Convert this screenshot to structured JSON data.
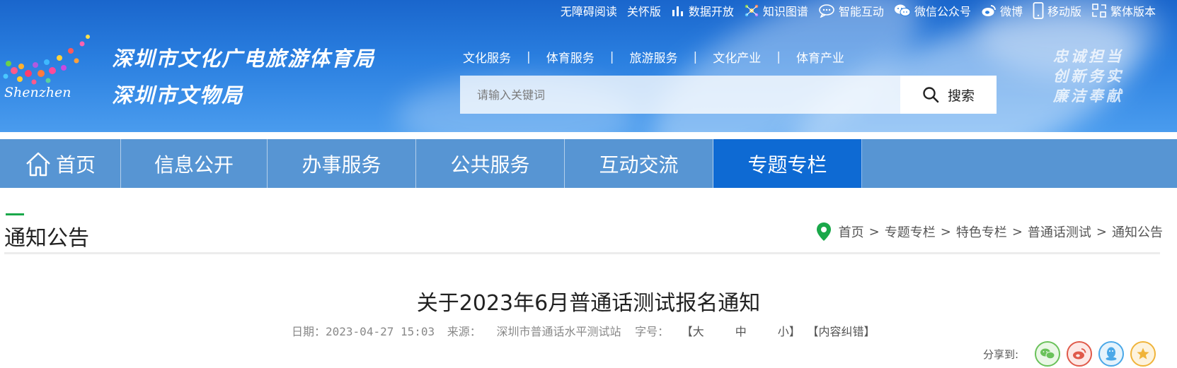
{
  "topbar": {
    "items": [
      {
        "label": "无障碍阅读",
        "icon": "none"
      },
      {
        "label": "关怀版",
        "icon": "none"
      },
      {
        "label": "数据开放",
        "icon": "bar-chart-icon"
      },
      {
        "label": "知识图谱",
        "icon": "knowledge-graph-icon"
      },
      {
        "label": "智能互动",
        "icon": "chat-bubble-icon"
      },
      {
        "label": "微信公众号",
        "icon": "wechat-icon"
      },
      {
        "label": "微博",
        "icon": "weibo-icon"
      },
      {
        "label": "移动版",
        "icon": "mobile-icon"
      },
      {
        "label": "繁体版本",
        "icon": "traditional-chinese-icon"
      }
    ]
  },
  "brand": {
    "logo_text": "Shenzhen",
    "org_name_1": "深圳市文化广电旅游体育局",
    "org_name_2": "深圳市文物局",
    "slogan": [
      "忠诚担当",
      "创新务实",
      "廉洁奉献"
    ]
  },
  "subnav": [
    "文化服务",
    "体育服务",
    "旅游服务",
    "文化产业",
    "体育产业"
  ],
  "subnav_separator": "|",
  "search": {
    "placeholder": "请输入关键词",
    "button_label": "搜索"
  },
  "mainnav": [
    {
      "label": "首页",
      "active": false
    },
    {
      "label": "信息公开",
      "active": false
    },
    {
      "label": "办事服务",
      "active": false
    },
    {
      "label": "公共服务",
      "active": false
    },
    {
      "label": "互动交流",
      "active": false
    },
    {
      "label": "专题专栏",
      "active": true
    }
  ],
  "section": {
    "title": "通知公告"
  },
  "breadcrumb": {
    "items": [
      "首页",
      "专题专栏",
      "特色专栏",
      "普通话测试",
      "通知公告"
    ],
    "separator": ">"
  },
  "article": {
    "title": "关于2023年6月普通话测试报名通知",
    "date_label": "日期：",
    "date": "2023-04-27 15:03",
    "source_label": "来源：",
    "source": "深圳市普通话水平测试站",
    "font_size_label": "字号：",
    "font_size_open": "【",
    "font_sizes": [
      "大",
      "中",
      "小"
    ],
    "font_size_close": "】",
    "correction_link": "【内容纠错】"
  },
  "share": {
    "label": "分享到:",
    "targets": [
      "wechat-icon",
      "weibo-icon",
      "qq-icon",
      "favorite-star-icon"
    ]
  },
  "colors": {
    "header_blue": "#2a7fe0",
    "nav_blue": "#5795d3",
    "nav_active": "#0e6ad3",
    "accent_green": "#1aa84a"
  }
}
